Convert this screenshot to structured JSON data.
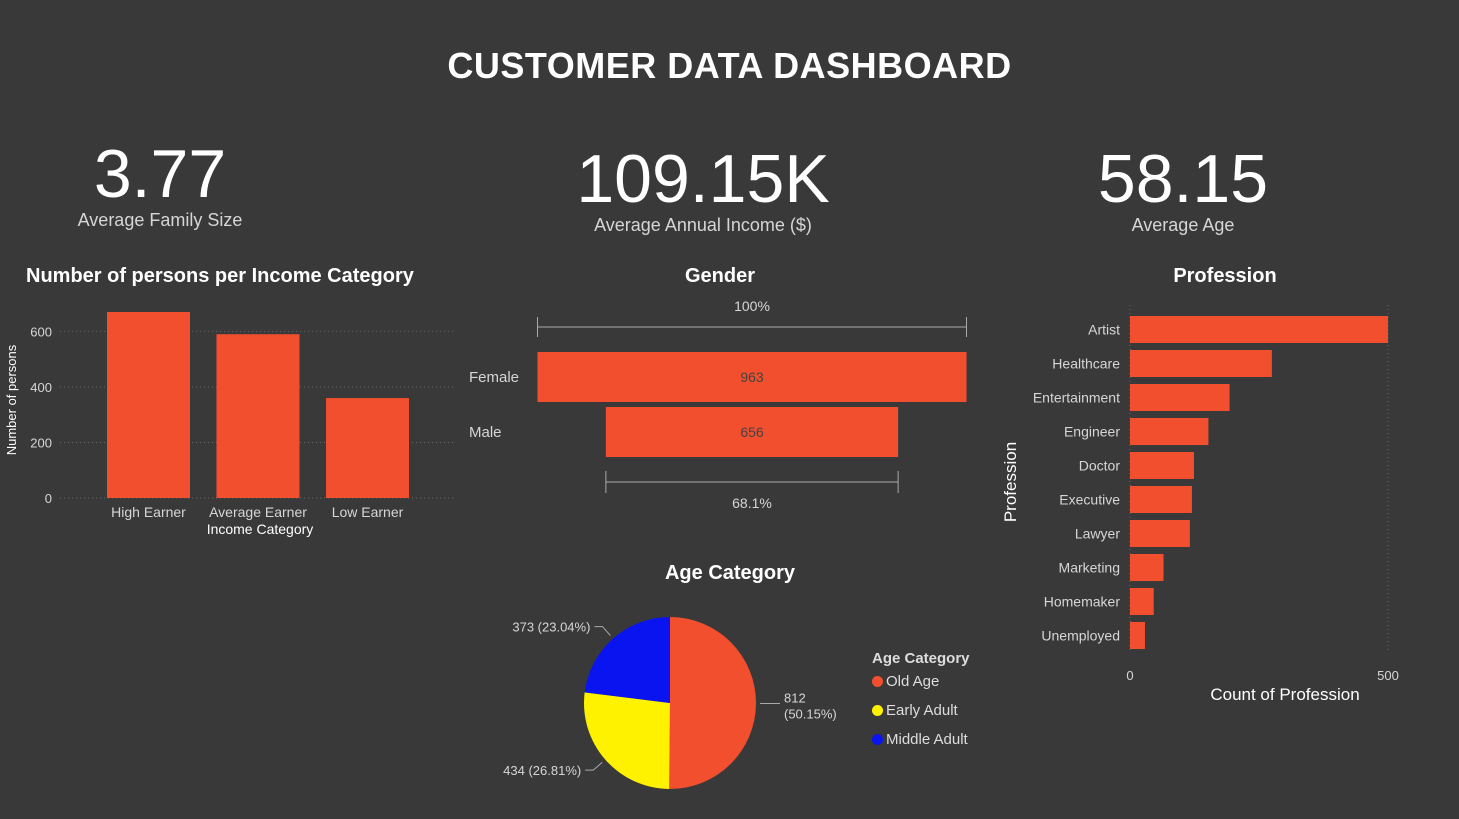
{
  "title": "CUSTOMER DATA DASHBOARD",
  "kpis": [
    {
      "value": "3.77",
      "label": "Average Family Size"
    },
    {
      "value": "109.15K",
      "label": "Average Annual Income ($)"
    },
    {
      "value": "58.15",
      "label": "Average Age"
    }
  ],
  "colors": {
    "background": "#393939",
    "bar": "#F24F2E",
    "old_age": "#F24F2E",
    "early_adult": "#FFF200",
    "middle_adult": "#0A14F0"
  },
  "chart_data": [
    {
      "id": "income",
      "type": "bar",
      "title": "Number of persons per Income Category",
      "xlabel": "Income Category",
      "ylabel": "Number of persons",
      "categories": [
        "High Earner",
        "Average Earner",
        "Low Earner"
      ],
      "values": [
        670,
        590,
        360
      ],
      "ylim": [
        0,
        670
      ],
      "yticks": [
        0,
        200,
        400,
        600
      ],
      "grid": true
    },
    {
      "id": "gender",
      "type": "funnel",
      "title": "Gender",
      "categories": [
        "Female",
        "Male"
      ],
      "values": [
        963,
        656
      ],
      "top_label": "100%",
      "bottom_label": "68.1%"
    },
    {
      "id": "age",
      "type": "pie",
      "title": "Age Category",
      "legend_title": "Age Category",
      "legend_position": "right",
      "slices": [
        {
          "name": "Old Age",
          "value": 812,
          "label_line1": "812",
          "label_line2": "(50.15%)"
        },
        {
          "name": "Early Adult",
          "value": 434,
          "label_line1": "434 (26.81%)",
          "label_line2": ""
        },
        {
          "name": "Middle Adult",
          "value": 373,
          "label_line1": "373 (23.04%)",
          "label_line2": ""
        }
      ]
    },
    {
      "id": "profession",
      "type": "bar",
      "orientation": "horizontal",
      "title": "Profession",
      "xlabel": "Count of Profession",
      "ylabel": "Profession",
      "categories": [
        "Artist",
        "Healthcare",
        "Entertainment",
        "Engineer",
        "Doctor",
        "Executive",
        "Lawyer",
        "Marketing",
        "Homemaker",
        "Unemployed"
      ],
      "values": [
        500,
        275,
        193,
        152,
        124,
        120,
        116,
        65,
        46,
        29
      ],
      "xlim": [
        0,
        500
      ],
      "xticks": [
        0,
        500
      ]
    }
  ]
}
